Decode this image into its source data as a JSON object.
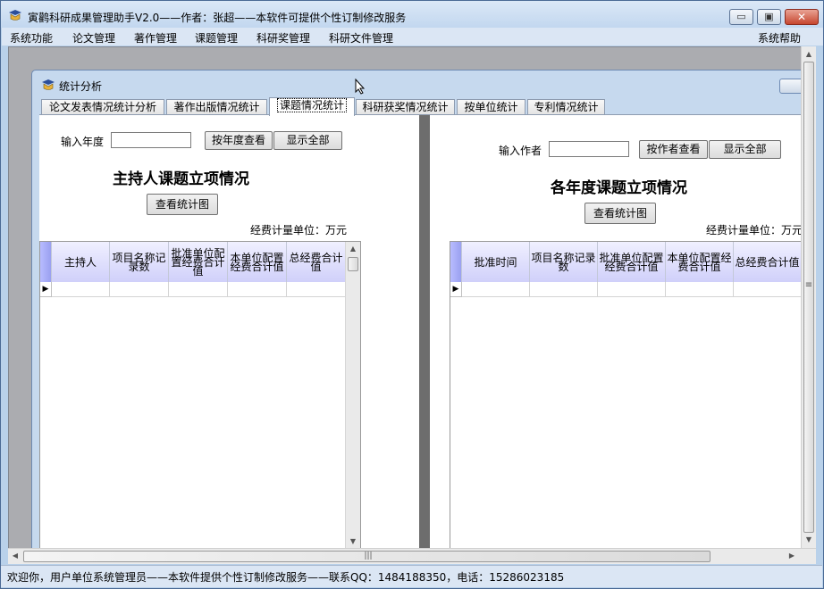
{
  "window": {
    "title": "寅鹳科研成果管理助手V2.0——作者：张超——本软件可提供个性订制修改服务",
    "min_glyph": "▭",
    "max_glyph": "▣",
    "close_glyph": "✕"
  },
  "menu": {
    "items": [
      "系统功能",
      "论文管理",
      "著作管理",
      "课题管理",
      "科研奖管理",
      "科研文件管理"
    ],
    "help": "系统帮助"
  },
  "child": {
    "title": "统计分析",
    "tabs": [
      "论文发表情况统计分析",
      "著作出版情况统计",
      "课题情况统计",
      "科研获奖情况统计",
      "按单位统计",
      "专利情况统计"
    ],
    "active_tab": 2
  },
  "left": {
    "year_label": "输入年度",
    "year_value": "",
    "btn_query": "按年度查看",
    "btn_all": "显示全部",
    "heading": "主持人课题立项情况",
    "btn_chart": "查看统计图",
    "unit": "经费计量单位：万元",
    "columns": [
      "主持人",
      "项目名称记录数",
      "批准单位配置经费合计值",
      "本单位配置经费合计值",
      "总经费合计值"
    ],
    "row_marker": "▶"
  },
  "right": {
    "author_label": "输入作者",
    "author_value": "",
    "btn_query": "按作者查看",
    "btn_all": "显示全部",
    "heading": "各年度课题立项情况",
    "btn_chart": "查看统计图",
    "unit": "经费计量单位：万元",
    "columns": [
      "批准时间",
      "项目名称记录数",
      "批准单位配置经费合计值",
      "本单位配置经费合计值",
      "总经费合计值"
    ],
    "row_marker": "▶"
  },
  "scroll": {
    "grip_v": "≡",
    "grip_h": "|||",
    "up": "▲",
    "down": "▼",
    "left": "◀",
    "right": "▶"
  },
  "status": {
    "text": "欢迎你，用户单位系统管理员——本软件提供个性订制修改服务——联系QQ：1484188350，电话：15286023185"
  }
}
